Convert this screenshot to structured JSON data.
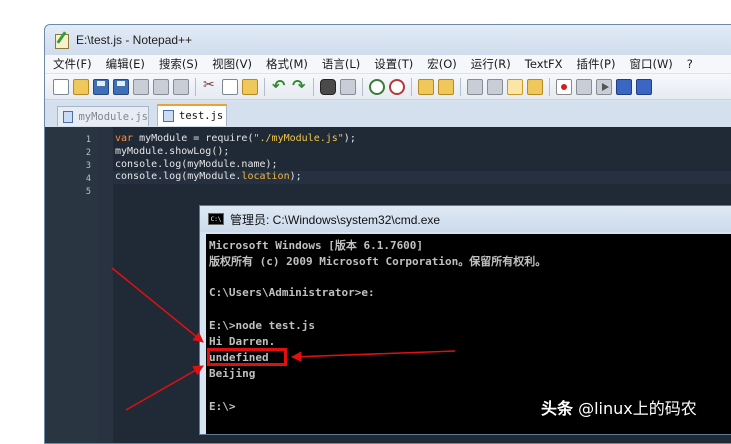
{
  "notepad": {
    "title": "E:\\test.js - Notepad++",
    "menu": [
      "文件(F)",
      "编辑(E)",
      "搜索(S)",
      "视图(V)",
      "格式(M)",
      "语言(L)",
      "设置(T)",
      "宏(O)",
      "运行(R)",
      "TextFX",
      "插件(P)",
      "窗口(W)",
      "?"
    ],
    "tabs": [
      {
        "label": "myModule.js",
        "active": false
      },
      {
        "label": "test.js",
        "active": true
      }
    ],
    "line_numbers": [
      "1",
      "2",
      "3",
      "4",
      "5"
    ],
    "code": {
      "l1_kw": "var",
      "l1_rest": " myModule = require(",
      "l1_str": "\"./myModule.js\"",
      "l1_end": ");",
      "l2": "myModule.showLog();",
      "l3": "console.log(myModule.name);",
      "l4_pre": "console.log(myModule.",
      "l4_prop": "location",
      "l4_end": ");"
    }
  },
  "cmd": {
    "title": "管理员: C:\\Windows\\system32\\cmd.exe",
    "icon_label": "C:\\",
    "lines": [
      "Microsoft Windows [版本 6.1.7600]",
      "版权所有 (c) 2009 Microsoft Corporation。保留所有权利。",
      "C:\\Users\\Administrator>e:",
      "E:\\>node test.js",
      "Hi Darren.",
      "undefined",
      "Beijing",
      "E:\\>"
    ]
  },
  "annotation": {
    "highlight_color": "#e01010",
    "highlighted_text": "undefined"
  },
  "watermark": {
    "brand": "头条",
    "handle": "@linux上的码农"
  },
  "colors": {
    "editor_bg": "#1f2a36",
    "keyword": "#ff8a3d",
    "string": "#f2c744",
    "console_bg": "#000000",
    "console_text": "#c0c0c0"
  }
}
